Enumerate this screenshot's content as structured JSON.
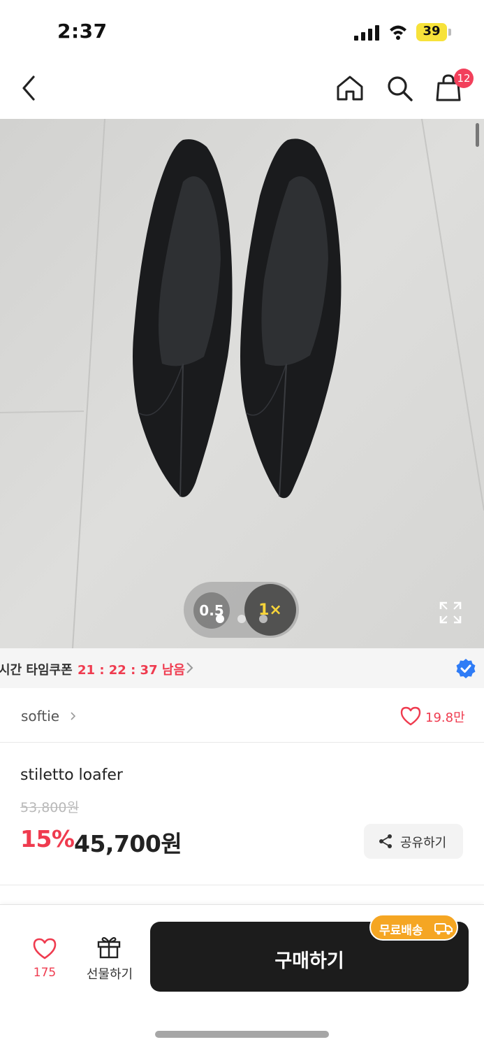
{
  "status_bar": {
    "time": "2:37",
    "battery": "39"
  },
  "nav": {
    "cart_count": "12"
  },
  "gallery": {
    "zoom_options": [
      "0.5",
      "1×"
    ],
    "active_zoom": "1×",
    "image_count": 3,
    "active_image_index": 0
  },
  "coupon": {
    "label": "시간 타임쿠폰",
    "timer": "21 : 22 : 37 남음"
  },
  "seller": {
    "name": "softie",
    "likes": "19.8만"
  },
  "product": {
    "name": "stiletto loafer",
    "original_price": "53,800원",
    "discount_rate": "15%",
    "sale_price": "45,700원",
    "share_label": "공유하기"
  },
  "bottom_bar": {
    "wish_count": "175",
    "gift_label": "선물하기",
    "buy_label": "구매하기",
    "free_shipping_label": "무료배송"
  },
  "colors": {
    "accent": "#ef3b4f",
    "buy_button": "#1c1c1c",
    "free_shipping_badge": "#f5a623",
    "verified": "#2f7cf6",
    "battery": "#f7e23a"
  },
  "icons": [
    "back-icon",
    "home-icon",
    "search-icon",
    "cart-icon",
    "expand-icon",
    "verified-icon",
    "heart-icon",
    "share-icon",
    "gift-icon",
    "truck-icon"
  ]
}
